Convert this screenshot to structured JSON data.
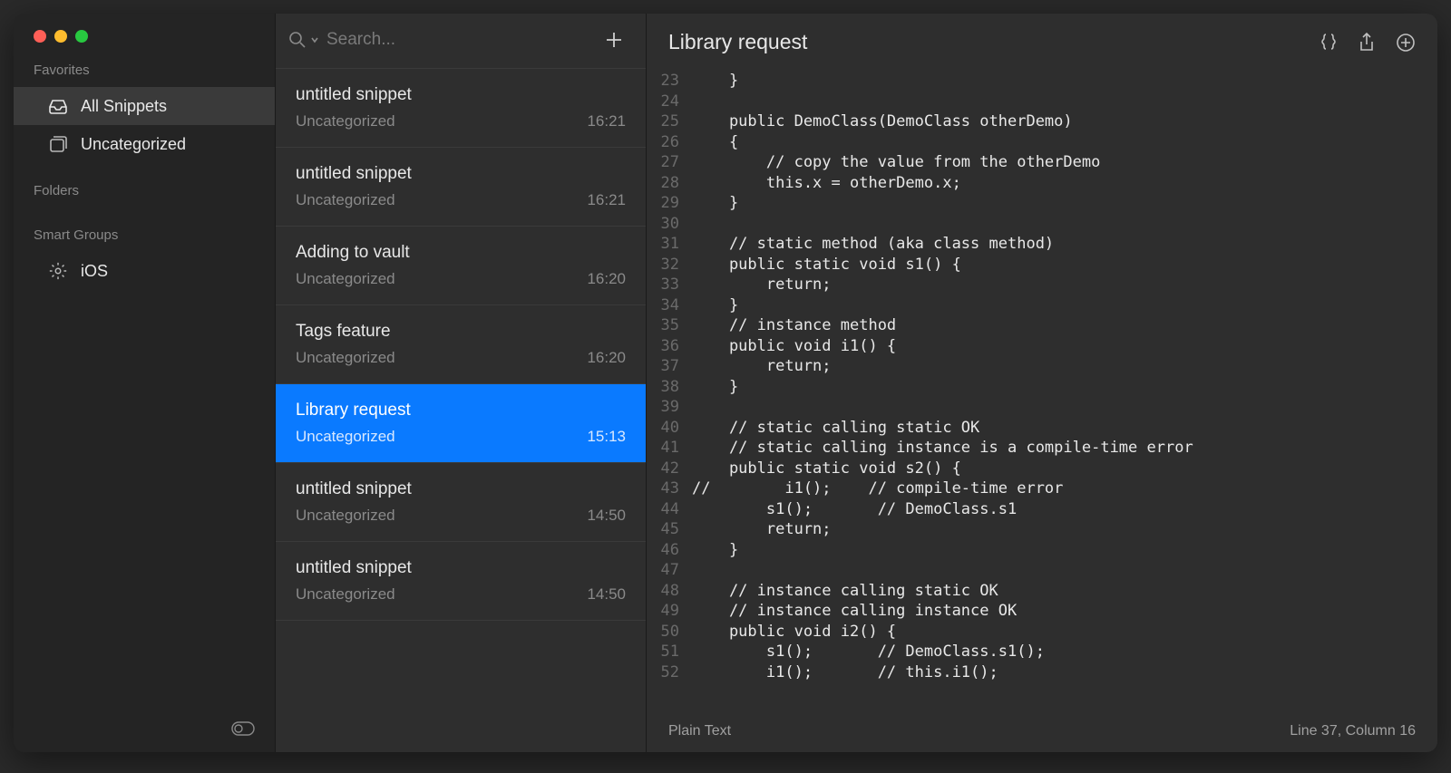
{
  "sidebar": {
    "sections": {
      "favorites_label": "Favorites",
      "folders_label": "Folders",
      "smart_groups_label": "Smart Groups"
    },
    "favorites": [
      {
        "label": "All Snippets",
        "icon": "tray-icon",
        "active": true
      },
      {
        "label": "Uncategorized",
        "icon": "square-stack-icon",
        "active": false
      }
    ],
    "smart_groups": [
      {
        "label": "iOS",
        "icon": "gear-icon"
      }
    ]
  },
  "search": {
    "placeholder": "Search..."
  },
  "snippets": [
    {
      "title": "untitled snippet",
      "category": "Uncategorized",
      "time": "16:21",
      "selected": false
    },
    {
      "title": "untitled snippet",
      "category": "Uncategorized",
      "time": "16:21",
      "selected": false
    },
    {
      "title": "Adding to vault",
      "category": "Uncategorized",
      "time": "16:20",
      "selected": false
    },
    {
      "title": "Tags feature",
      "category": "Uncategorized",
      "time": "16:20",
      "selected": false
    },
    {
      "title": "Library request",
      "category": "Uncategorized",
      "time": "15:13",
      "selected": true
    },
    {
      "title": "untitled snippet",
      "category": "Uncategorized",
      "time": "14:50",
      "selected": false
    },
    {
      "title": "untitled snippet",
      "category": "Uncategorized",
      "time": "14:50",
      "selected": false
    }
  ],
  "editor": {
    "title": "Library request",
    "language": "Plain Text",
    "cursor": "Line 37, Column 16",
    "code_start_line": 23,
    "code_lines": [
      "    }",
      "",
      "    public DemoClass(DemoClass otherDemo)",
      "    {",
      "        // copy the value from the otherDemo",
      "        this.x = otherDemo.x;",
      "    }",
      "",
      "    // static method (aka class method)",
      "    public static void s1() {",
      "        return;",
      "    }",
      "    // instance method",
      "    public void i1() {",
      "        return;",
      "    }",
      "",
      "    // static calling static OK",
      "    // static calling instance is a compile-time error",
      "    public static void s2() {",
      "//        i1();    // compile-time error",
      "        s1();       // DemoClass.s1",
      "        return;",
      "    }",
      "",
      "    // instance calling static OK",
      "    // instance calling instance OK",
      "    public void i2() {",
      "        s1();       // DemoClass.s1();",
      "        i1();       // this.i1();"
    ]
  }
}
